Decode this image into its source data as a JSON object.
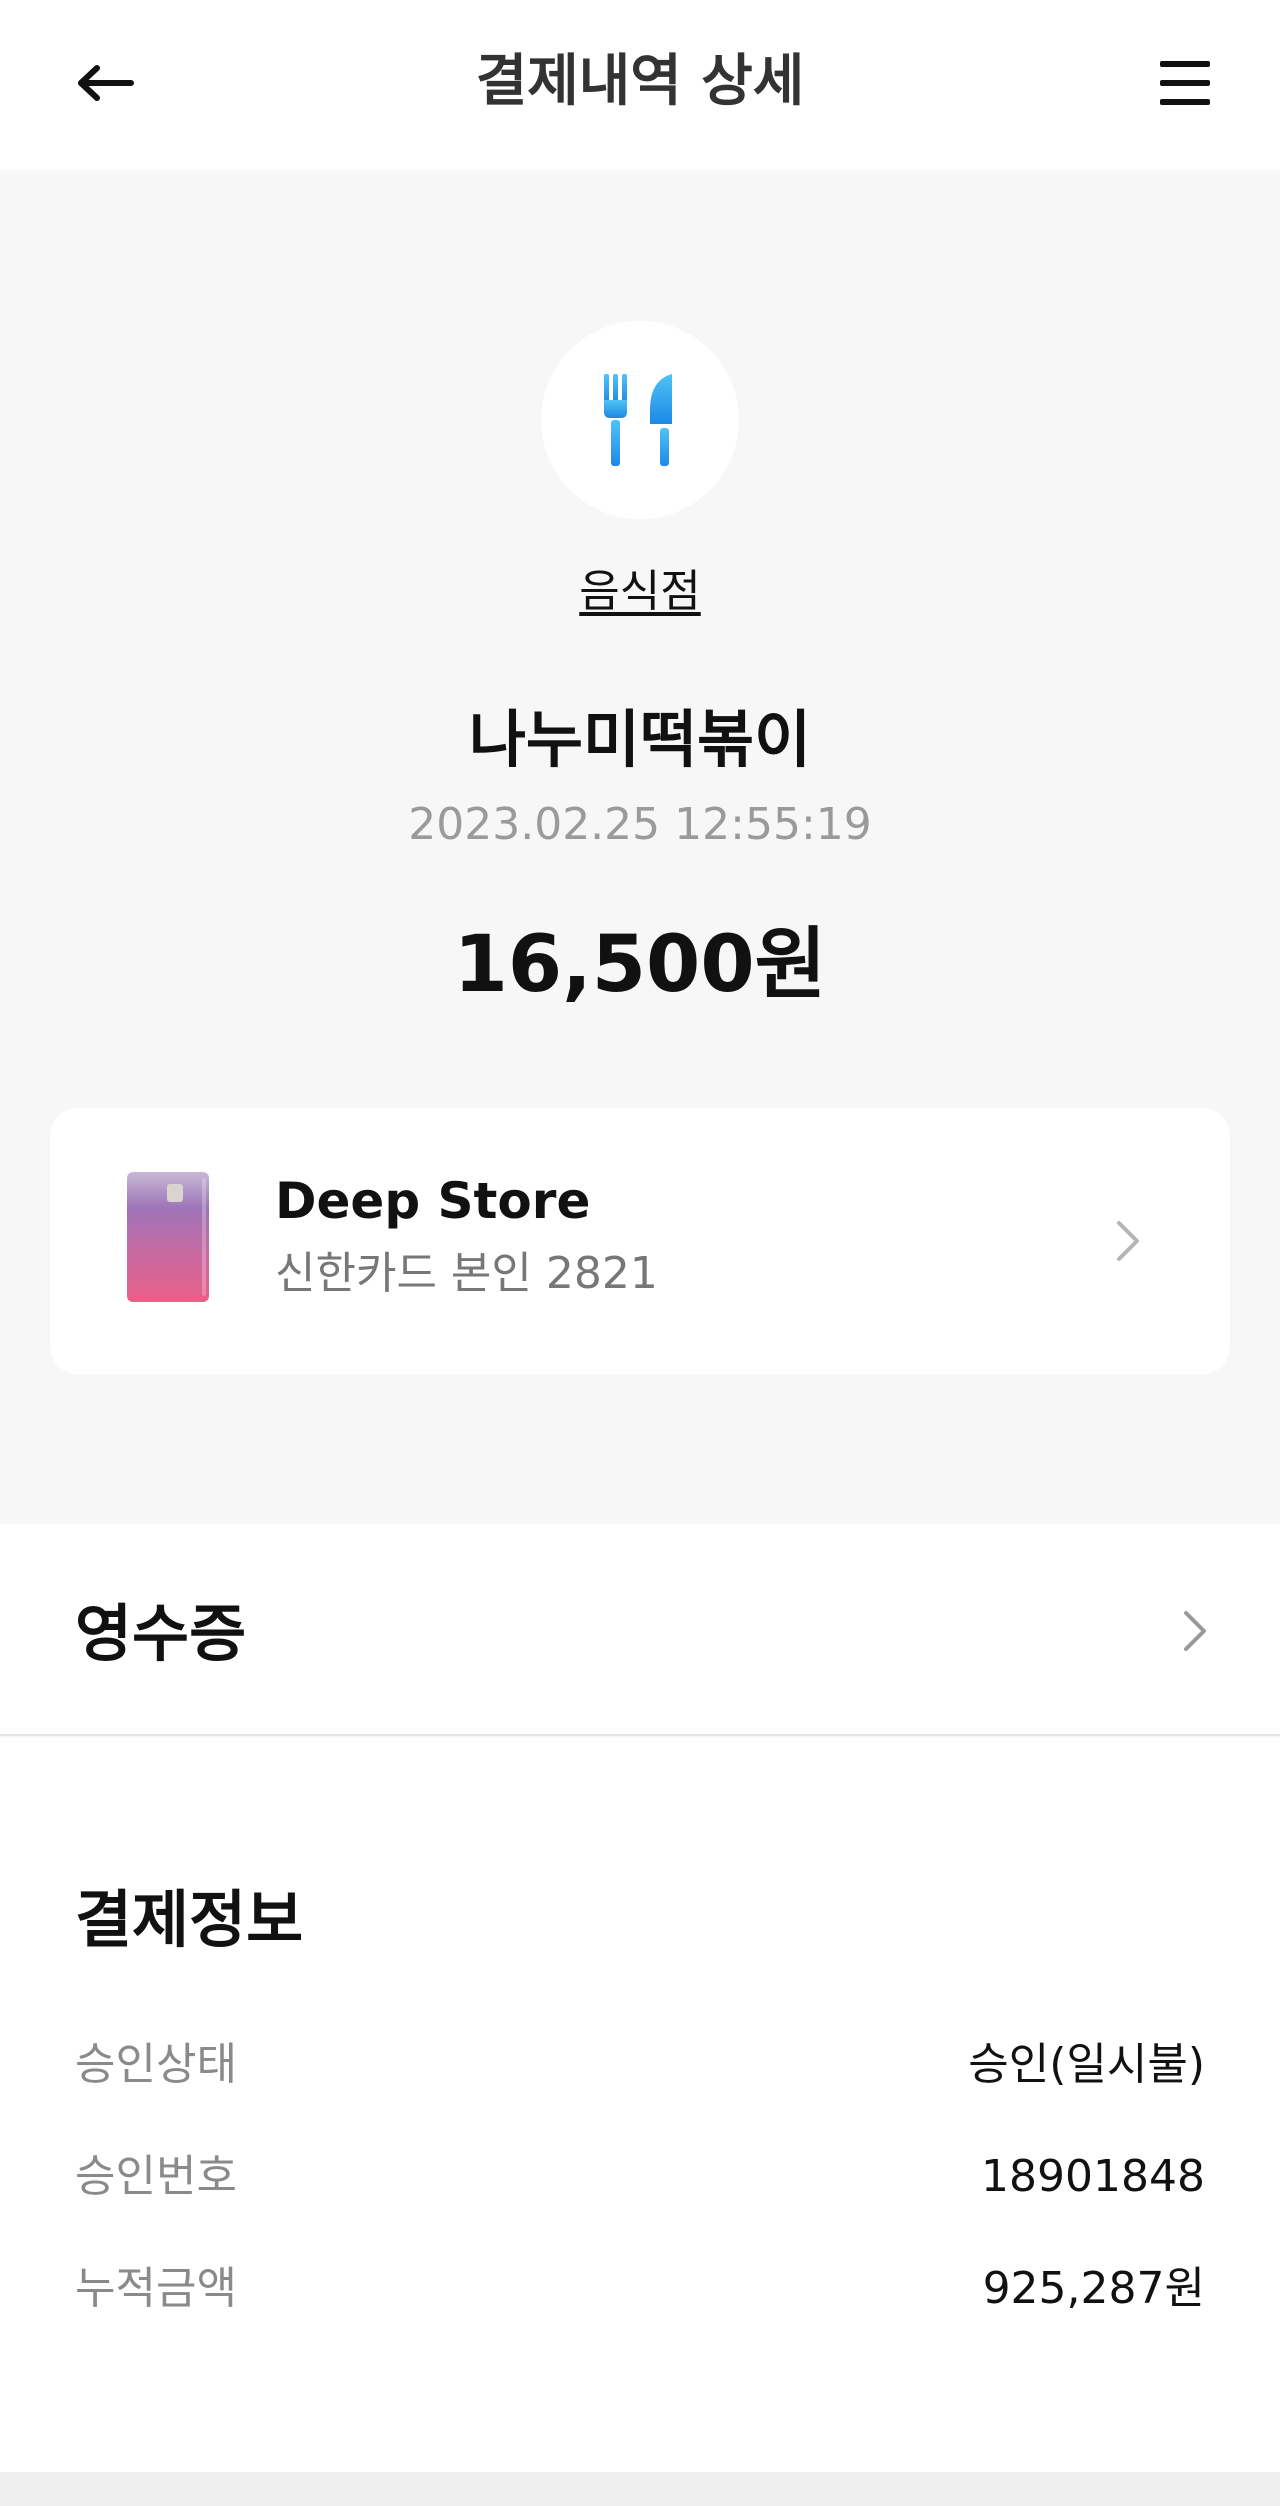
{
  "header": {
    "title": "결제내역 상세",
    "back_icon": "arrow-left-icon",
    "menu_icon": "hamburger-menu-icon"
  },
  "summary": {
    "category_icon": "fork-knife-icon",
    "category": "음식점",
    "merchant": "나누미떡볶이",
    "datetime": "2023.02.25 12:55:19",
    "amount": "16,500원",
    "accent_color": "#29b6f6"
  },
  "card": {
    "name": "Deep Store",
    "detail": "신한카드 본인 2821",
    "chevron_icon": "chevron-right-icon"
  },
  "receipt": {
    "label": "영수증",
    "chevron_icon": "chevron-right-icon"
  },
  "payment_info": {
    "title": "결제정보",
    "rows": [
      {
        "key": "승인상태",
        "value": "승인(일시불)"
      },
      {
        "key": "승인번호",
        "value": "18901848"
      },
      {
        "key": "누적금액",
        "value": "925,287원"
      }
    ]
  }
}
